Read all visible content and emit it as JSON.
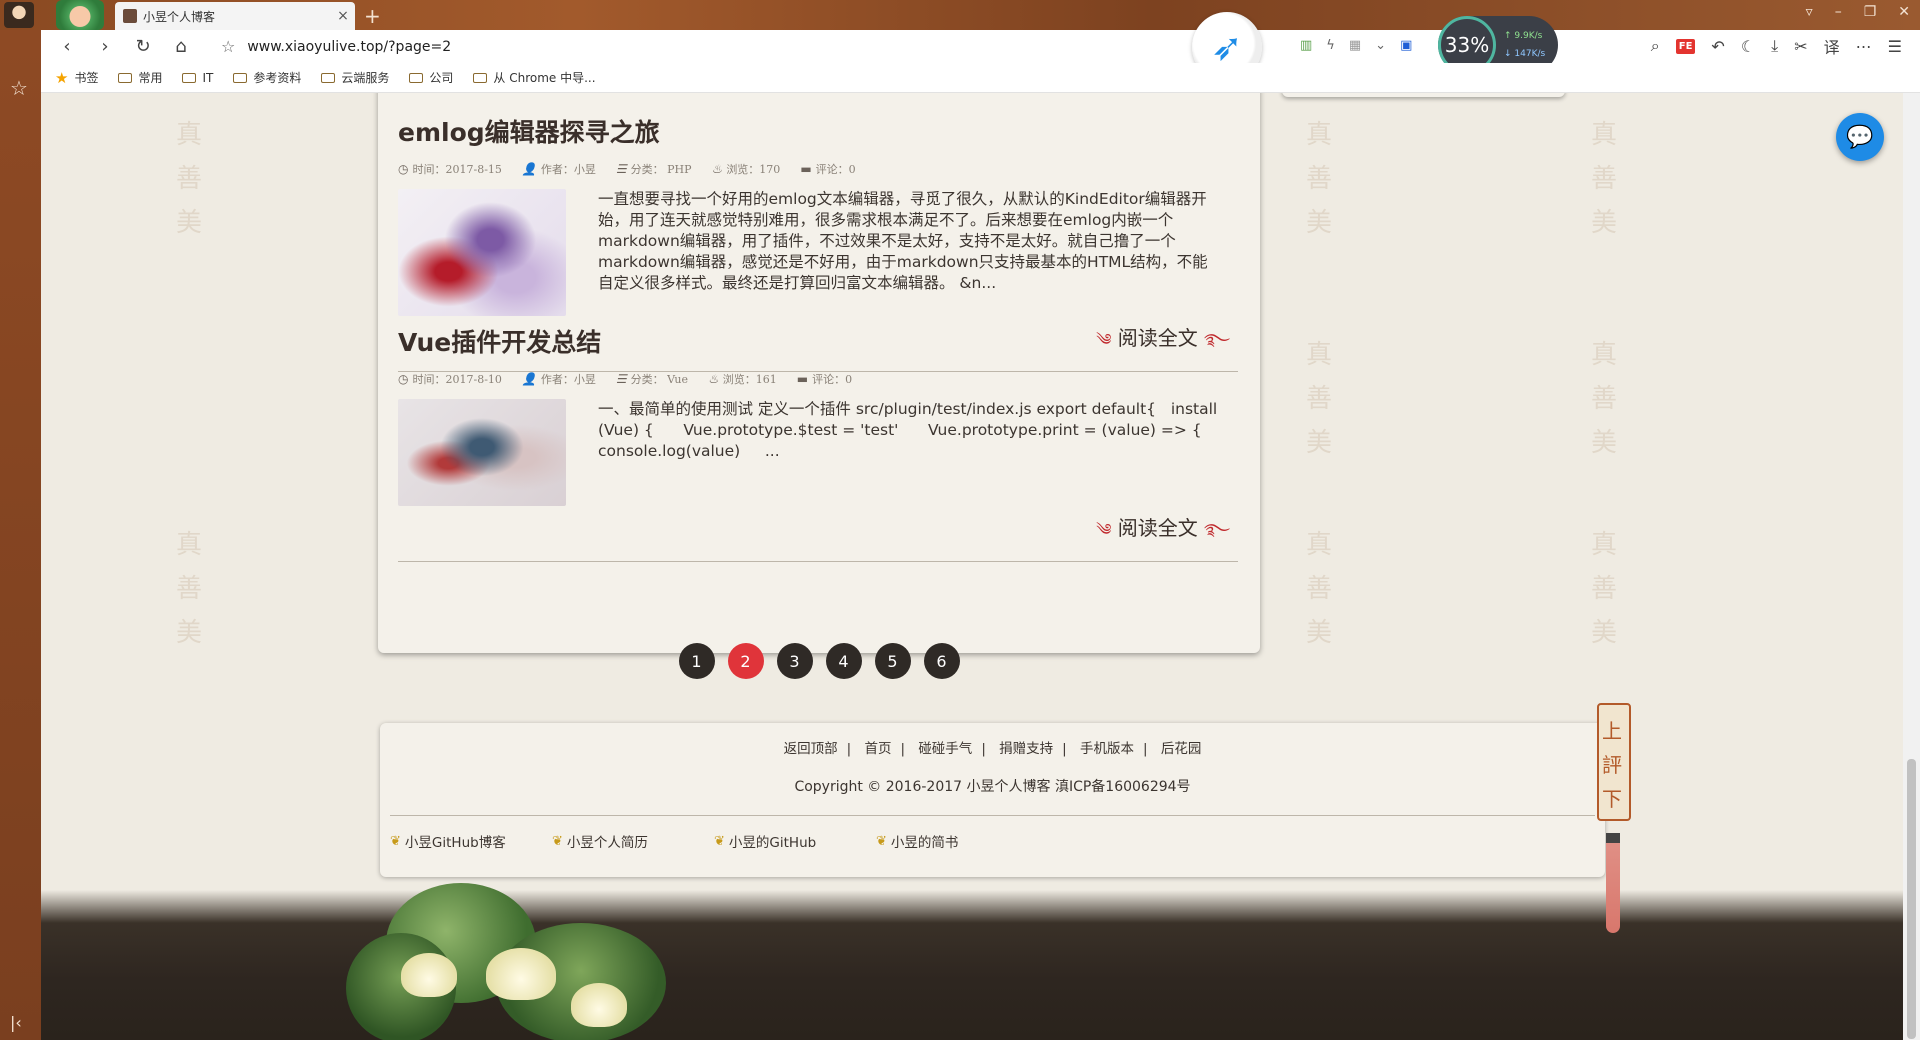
{
  "browser": {
    "tab_title": "小昱个人博客",
    "tab_close": "×",
    "new_tab": "+",
    "address": "www.xiaoyulive.top/?page=2",
    "nav": {
      "back": "‹",
      "forward": "›",
      "reload": "↻",
      "home": "⌂"
    },
    "speed": {
      "percent": "33%",
      "upload": "↑ 9.9K/s",
      "download": "↓ 147K/s"
    },
    "translate": "译",
    "bookmarks": [
      "书签",
      "常用",
      "IT",
      "参考资料",
      "云端服务",
      "公司",
      "从 Chrome 中导..."
    ]
  },
  "articles": [
    {
      "title": "emlog编辑器探寻之旅",
      "meta": {
        "time": "时间：2017-8-15",
        "author": "作者：小昱",
        "category": "分类： PHP",
        "views": "浏览：170",
        "comments": "评论：0"
      },
      "excerpt": "一直想要寻找一个好用的emlog文本编辑器，寻觅了很久，从默认的KindEditor编辑器开始，用了连天就感觉特别难用，很多需求根本满足不了。后来想要在emlog内嵌一个markdown编辑器，用了插件，不过效果不是太好，支持不是太好。就自己撸了一个markdown编辑器，感觉还是不好用，由于markdown只支持最基本的HTML结构，不能自定义很多样式。最终还是打算回归富文本编辑器。 &n...",
      "read_more": "阅读全文"
    },
    {
      "title": "Vue插件开发总结",
      "meta": {
        "time": "时间：2017-8-10",
        "author": "作者：小昱",
        "category": "分类： Vue",
        "views": "浏览：161",
        "comments": "评论：0"
      },
      "excerpt": "一、最简单的使用测试 定义一个插件 src/plugin/test/index.js export default{   install (Vue) {      Vue.prototype.$test = 'test'      Vue.prototype.print = (value) => {          console.log(value)     ...",
      "read_more": "阅读全文"
    }
  ],
  "pagination": {
    "pages": [
      "1",
      "2",
      "3",
      "4",
      "5",
      "6"
    ],
    "current": "2"
  },
  "footer": {
    "links": [
      "返回顶部",
      "首页",
      "碰碰手气",
      "捐赠支持",
      "手机版本",
      "后花园"
    ],
    "copyright": "Copyright © 2016-2017 小昱个人博客 滇ICP备16006294号",
    "friends": [
      "小昱GitHub博客",
      "小昱个人简历",
      "小昱的GitHub",
      "小昱的简书"
    ]
  },
  "scroll_widget": {
    "up": "上",
    "mid": "評",
    "down": "下"
  },
  "watermark": [
    "真",
    "善",
    "美"
  ],
  "colors": {
    "active_page": "#e0343a",
    "page_button": "#2f2a26",
    "chat_button": "#1e8be6",
    "accent_red": "#c0282c"
  },
  "icons": [
    "clock-icon",
    "user-icon",
    "list-icon",
    "fire-icon",
    "comment-icon",
    "chat-icon",
    "leaf-icon"
  ]
}
